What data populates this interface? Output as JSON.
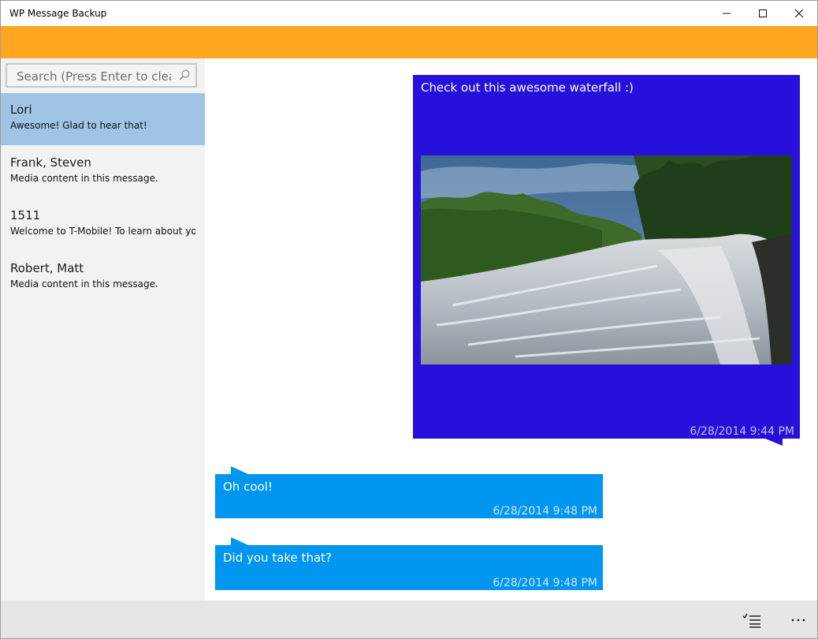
{
  "window": {
    "title": "WP Message Backup"
  },
  "search": {
    "placeholder": "Search (Press Enter to clear s"
  },
  "conversations": [
    {
      "name": "Lori",
      "preview": "Awesome! Glad to hear that!"
    },
    {
      "name": "Frank, Steven",
      "preview": "Media content in this message."
    },
    {
      "name": "1511",
      "preview": "Welcome to T-Mobile! To learn about your p"
    },
    {
      "name": "Robert, Matt",
      "preview": "Media content in this message."
    }
  ],
  "messages": [
    {
      "text": "Check out this awesome waterfall :)",
      "timestamp": "6/28/2014 9:44 PM",
      "direction": "sent",
      "media": "waterfall photo"
    },
    {
      "text": "Oh cool!",
      "timestamp": "6/28/2014 9:48 PM",
      "direction": "received"
    },
    {
      "text": "Did you take that?",
      "timestamp": "6/28/2014 9:48 PM",
      "direction": "received"
    }
  ],
  "colors": {
    "accent_bar": "#ffa51f",
    "selected_item": "#a0c5e4",
    "sent_bubble": "#2710dc",
    "received_bubble": "#0096f0"
  },
  "icons": {
    "minimize": "minimize-icon",
    "maximize": "maximize-icon",
    "close": "close-icon",
    "search": "search-icon",
    "select": "select-list-icon",
    "more": "more-icon"
  }
}
